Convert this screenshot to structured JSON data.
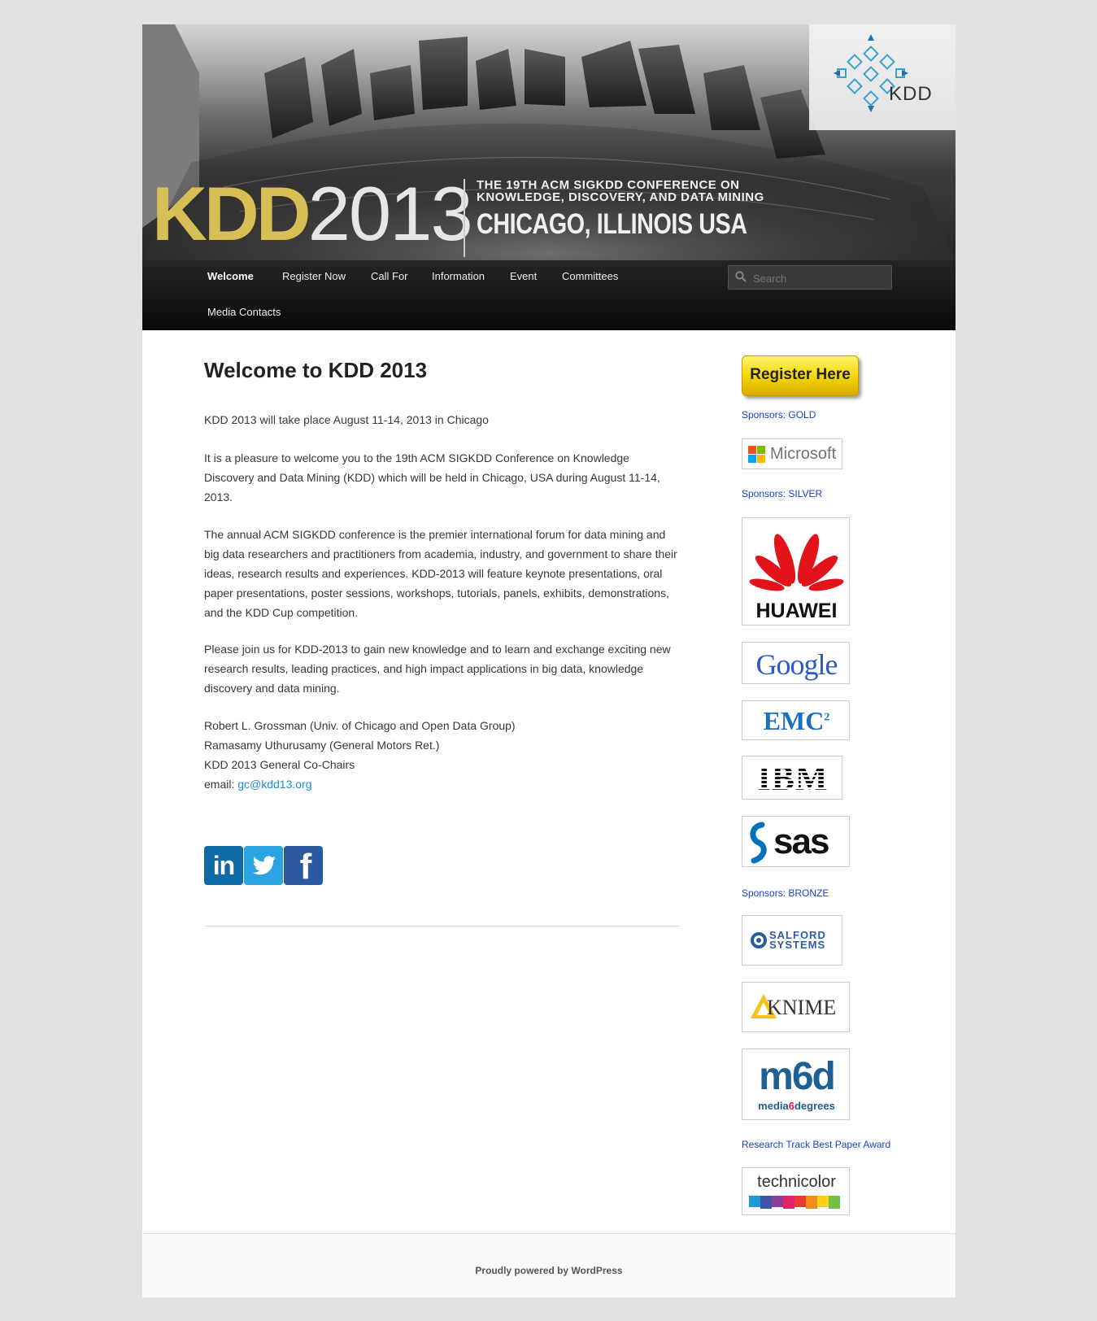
{
  "header": {
    "brand_kdd": "KDD",
    "brand_year": "2013",
    "conf_line1": "THE 19TH ACM SIGKDD CONFERENCE ON",
    "conf_line2": "KNOWLEDGE, DISCOVERY, AND DATA MINING",
    "conf_city": "CHICAGO, ILLINOIS USA",
    "logo_text": "KDD"
  },
  "nav": {
    "items": [
      {
        "label": "Welcome"
      },
      {
        "label": "Register Now"
      },
      {
        "label": "Call For"
      },
      {
        "label": "Information"
      },
      {
        "label": "Event"
      },
      {
        "label": "Committees"
      },
      {
        "label": "Media Contacts"
      }
    ],
    "search_placeholder": "Search"
  },
  "main": {
    "title": "Welcome to KDD 2013",
    "p1": "KDD 2013 will take place August 11-14, 2013 in Chicago",
    "p2": "It is a pleasure to welcome you to the 19th ACM SIGKDD Conference on Knowledge Discovery and Data Mining (KDD) which will be held in Chicago, USA during August 11-14, 2013.",
    "p3": "The annual ACM SIGKDD conference is the premier international forum for data mining and big data researchers and practitioners from academia, industry, and government to share their ideas, research results and experiences. KDD-2013 will feature keynote presentations, oral paper presentations, poster sessions, workshops, tutorials, panels, exhibits, demonstrations, and the KDD Cup competition.",
    "p4": "Please join us for KDD-2013 to gain new knowledge and to learn and exchange exciting new research results, leading practices, and high impact applications in big data, knowledge discovery and data mining.",
    "sig1": "Robert L. Grossman (Univ. of Chicago and Open Data Group)",
    "sig2": "Ramasamy Uthurusamy (General Motors Ret.)",
    "sig3": "KDD 2013 General Co-Chairs",
    "email_label": "email: ",
    "email": "gc@kdd13.org",
    "social": [
      "in",
      "f"
    ]
  },
  "sidebar": {
    "register": "Register Here",
    "gold": "Sponsors: GOLD",
    "silver": "Sponsors: SILVER",
    "bronze": "Sponsors: BRONZE",
    "award": "Research Track Best Paper Award",
    "logos": {
      "microsoft": "Microsoft",
      "huawei": "HUAWEI",
      "google": "Google",
      "emc": "EMC",
      "emc_sup": "2",
      "ibm": "IBM",
      "sas": "sas",
      "salford1": "SALFORD",
      "salford2": "SYSTEMS",
      "knime": "KNIME",
      "m6d": "m6d",
      "m6d_sub1": "media",
      "m6d_sub2": "6",
      "m6d_sub3": "degrees",
      "technicolor": "technicolor"
    }
  },
  "footer": {
    "text": "Proudly powered by WordPress"
  }
}
